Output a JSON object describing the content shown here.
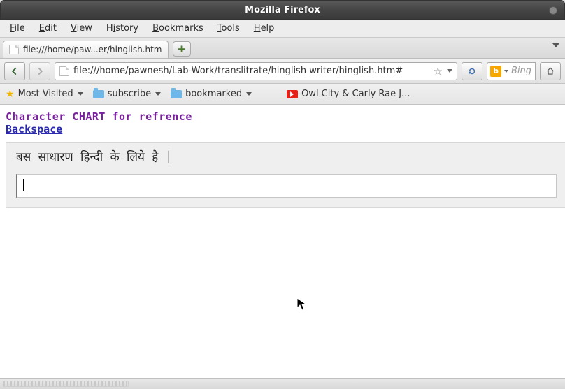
{
  "window": {
    "title": "Mozilla Firefox"
  },
  "menus": {
    "file": {
      "label": "File",
      "accel": "F"
    },
    "edit": {
      "label": "Edit",
      "accel": "E"
    },
    "view": {
      "label": "View",
      "accel": "V"
    },
    "history": {
      "label": "History",
      "accel": "i"
    },
    "bookmarks": {
      "label": "Bookmarks",
      "accel": "B"
    },
    "tools": {
      "label": "Tools",
      "accel": "T"
    },
    "help": {
      "label": "Help",
      "accel": "H"
    }
  },
  "tab": {
    "label": "file:///home/paw...er/hinglish.htm"
  },
  "url": {
    "value": "file:///home/pawnesh/Lab-Work/translitrate/hinglish writer/hinglish.htm#"
  },
  "search": {
    "engine": "b",
    "placeholder": "Bing"
  },
  "bookmarks_bar": {
    "most_visited": "Most Visited",
    "subscribe": "subscribe",
    "bookmarked": "bookmarked",
    "owl_city": "Owl City & Carly Rae J..."
  },
  "page": {
    "heading": "Character CHART for refrence",
    "backspace": "Backspace",
    "sample_text": "बस  साधारण  हिन्दी  के  लिये  है  |",
    "input_value": ""
  }
}
